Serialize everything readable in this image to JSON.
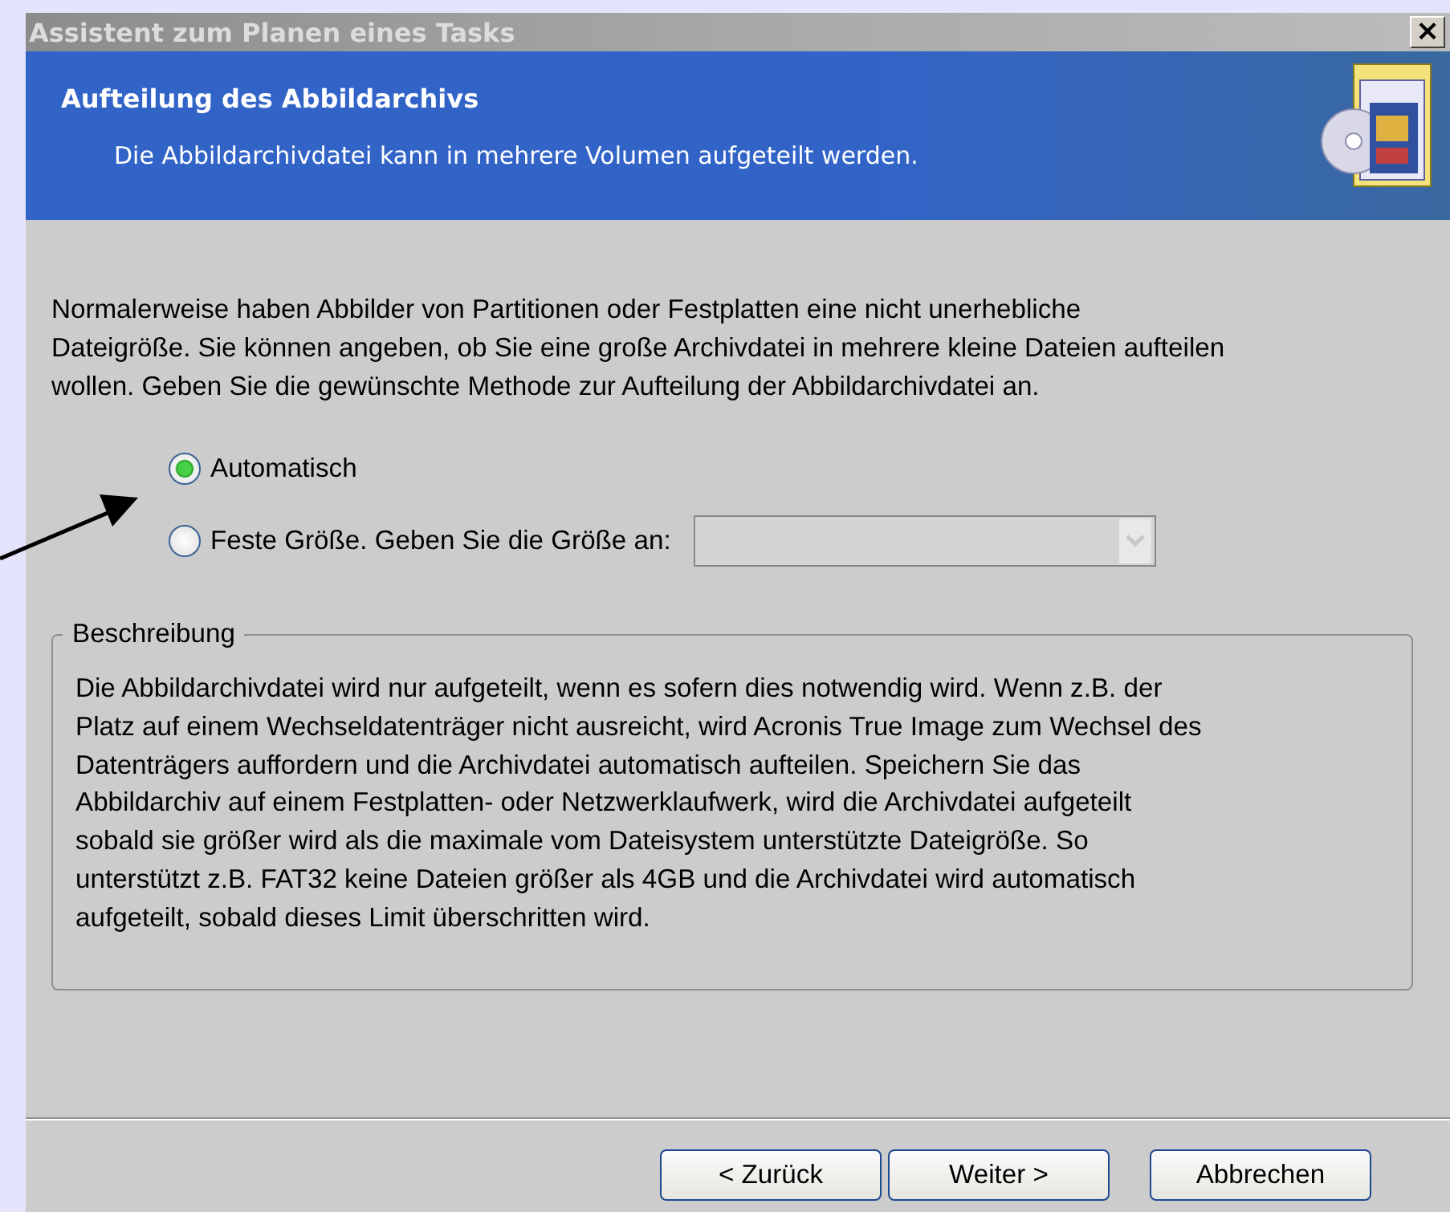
{
  "window": {
    "title": "Assistent zum Planen eines Tasks",
    "close": "×"
  },
  "header": {
    "title": "Aufteilung des Abbildarchivs",
    "subtitle": "Die Abbildarchivdatei kann in mehrere Volumen aufgeteilt werden."
  },
  "intro": [
    "Normalerweise haben Abbilder von Partitionen oder Festplatten eine nicht unerhebliche",
    "Dateigröße. Sie können angeben, ob Sie eine große Archivdatei in mehrere kleine Dateien aufteilen",
    "wollen. Geben Sie die gewünschte Methode zur Aufteilung der Abbildarchivdatei an."
  ],
  "options": [
    {
      "label": "Automatisch",
      "selected": true
    },
    {
      "label": "Feste Größe. Geben Sie die Größe an:",
      "selected": false
    }
  ],
  "size_field": {
    "disabled": true
  },
  "description": {
    "legend": "Beschreibung",
    "lines": [
      "Die Abbildarchivdatei wird nur aufgeteilt, wenn es sofern dies notwendig wird. Wenn z.B. der",
      "Platz auf einem Wechseldatenträger nicht ausreicht, wird Acronis True Image zum Wechsel des",
      "Datenträgers auffordern und die Archivdatei automatisch aufteilen. Speichern Sie das",
      "Abbildarchiv auf einem Festplatten- oder Netzwerklaufwerk, wird die Archivdatei aufgeteilt",
      "sobald sie größer wird als die maximale vom Dateisystem unterstützte Dateigröße. So",
      "unterstützt z.B. FAT32 keine Dateien größer als 4GB und die Archivdatei wird automatisch",
      "aufgeteilt, sobald dieses Limit überschritten wird."
    ]
  },
  "buttons": [
    "< Zurück",
    "Weiter >",
    "Abbrechen"
  ]
}
